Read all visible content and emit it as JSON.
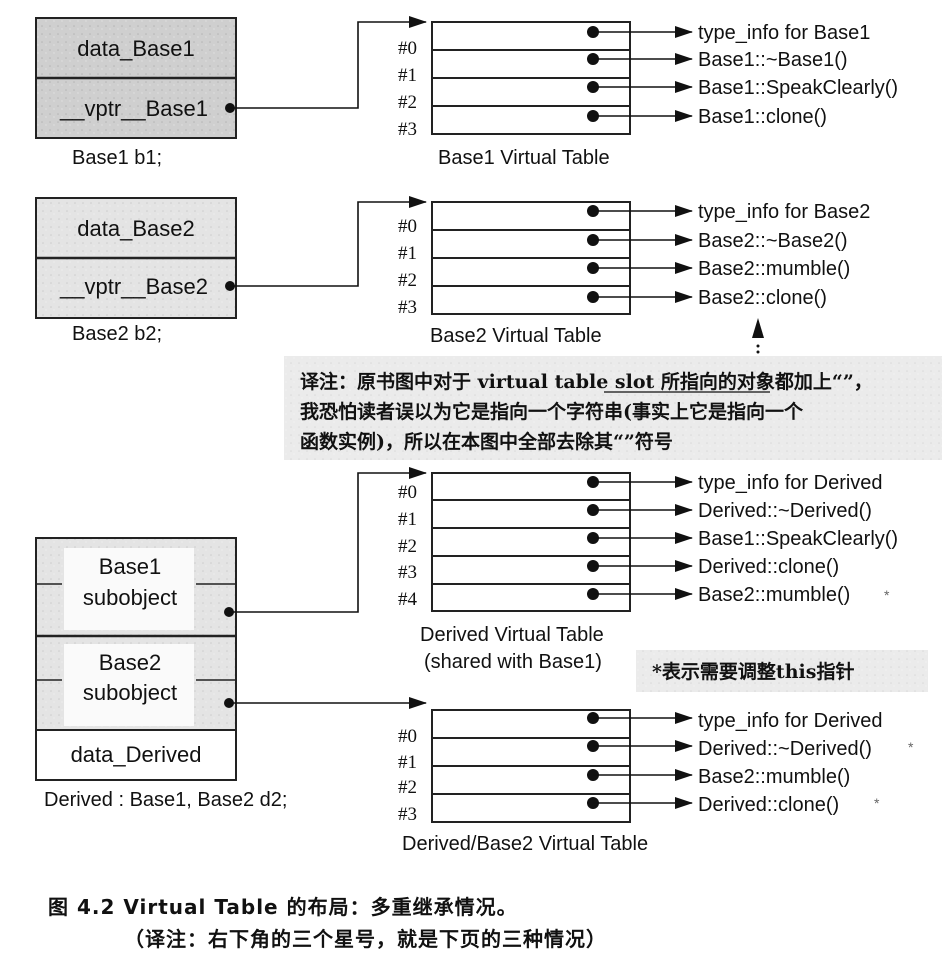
{
  "base1": {
    "data_label": "data_Base1",
    "vptr_label": "__vptr__Base1",
    "decl": "Base1  b1;",
    "table_title": "Base1 Virtual Table",
    "slots": [
      "#0",
      "#1",
      "#2",
      "#3"
    ],
    "entries": [
      "type_info for Base1",
      "Base1::~Base1()",
      "Base1::SpeakClearly()",
      "Base1::clone()"
    ]
  },
  "base2": {
    "data_label": "data_Base2",
    "vptr_label": "__vptr__Base2",
    "decl": "Base2  b2;",
    "table_title": "Base2 Virtual Table",
    "slots": [
      "#0",
      "#1",
      "#2",
      "#3"
    ],
    "entries": [
      "type_info for Base2",
      "Base2::~Base2()",
      "Base2::mumble()",
      "Base2::clone()"
    ]
  },
  "note": {
    "lines": [
      "译注：原书图中对于 virtual table slot 所指向的对象都加上“”，",
      "我恐怕读者误以为它是指向一个字符串(事实上它是指向一个",
      "函数实例)，所以在本图中全部去除其“”符号"
    ]
  },
  "derived": {
    "sub1_line1": "Base1",
    "sub1_line2": "subobject",
    "sub2_line1": "Base2",
    "sub2_line2": "subobject",
    "data_label": "data_Derived",
    "decl": "Derived : Base1, Base2 d2;",
    "table1_title_line1": "Derived Virtual Table",
    "table1_title_line2": "(shared with Base1)",
    "table1_slots": [
      "#0",
      "#1",
      "#2",
      "#3",
      "#4"
    ],
    "table1_entries": [
      "type_info for Derived",
      "Derived::~Derived()",
      "Base1::SpeakClearly()",
      "Derived::clone()",
      "Base2::mumble()"
    ],
    "adjust_note": "*表示需要调整this指针",
    "table2_title": "Derived/Base2 Virtual Table",
    "table2_slots": [
      "#0",
      "#1",
      "#2",
      "#3"
    ],
    "table2_entries": [
      "type_info for Derived",
      "Derived::~Derived()",
      "Base2::mumble()",
      "Derived::clone()"
    ],
    "star": "*"
  },
  "caption": {
    "line1": "图 4.2   Virtual Table 的布局：多重继承情况。",
    "line2": "（译注：右下角的三个星号，就是下页的三种情况）"
  }
}
